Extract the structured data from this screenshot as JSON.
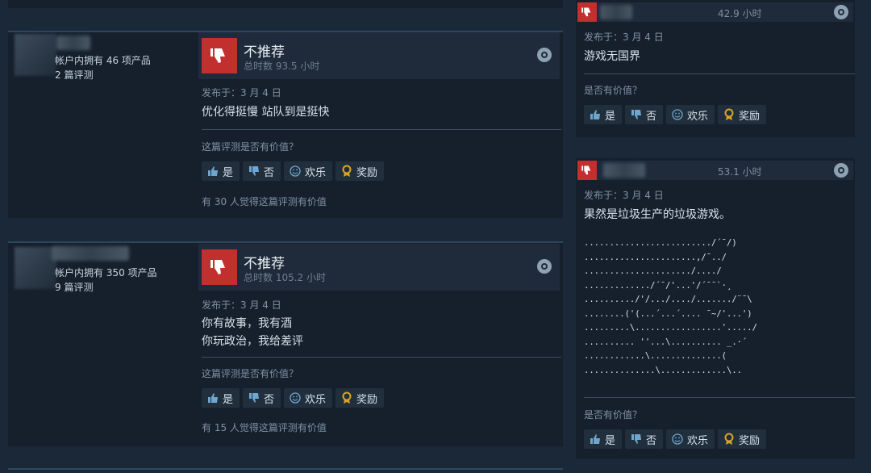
{
  "reviews_left": [
    {
      "author_meta_products": "帐户内拥有 46 项产品",
      "author_meta_reviews": "2 篇评测",
      "vote_title": "不推荐",
      "hours": "总时数 93.5 小时",
      "posted": "发布于：3 月 4 日",
      "body": "优化得挺慢 站队到是挺快",
      "helpful_question": "这篇评测是否有价值？",
      "btn_yes": "是",
      "btn_no": "否",
      "btn_funny": "欢乐",
      "btn_award": "奖励",
      "helpful_count": "有 30 人觉得这篇评测有价值"
    },
    {
      "author_meta_products": "帐户内拥有 350 项产品",
      "author_meta_reviews": "9 篇评测",
      "vote_title": "不推荐",
      "hours": "总时数 105.2 小时",
      "posted": "发布于：3 月 4 日",
      "body": "你有故事，我有酒\n你玩政治，我给差评",
      "helpful_question": "这篇评测是否有价值？",
      "btn_yes": "是",
      "btn_no": "否",
      "btn_funny": "欢乐",
      "btn_award": "奖励",
      "helpful_count": "有 15 人觉得这篇评测有价值"
    }
  ],
  "reviews_right": [
    {
      "hours": "42.9 小时",
      "posted": "发布于：3 月 4 日",
      "body": "游戏无国界",
      "helpful_question": "是否有价值？",
      "btn_yes": "是",
      "btn_no": "否",
      "btn_funny": "欢乐",
      "btn_award": "奖励"
    },
    {
      "hours": "53.1 小时",
      "posted": "发布于：3 月 4 日",
      "body": "果然是垃圾生产的垃圾游戏。",
      "ascii_art": "........................./´¯/)\n......................,/¯../\n...................../..../\n............./´¯/'...'/´¯¯`·¸\n........../'/.../..../......./¨¯\\\n........('(...´...´.... ¯~/'...')\n.........\\.................'...../\n.......... ''...\\.......... _.·´\n............\\..............(\n..............\\.............\\..",
      "helpful_question": "是否有价值？",
      "btn_yes": "是",
      "btn_no": "否",
      "btn_funny": "欢乐",
      "btn_award": "奖励"
    }
  ],
  "colors": {
    "background": "#1b2838",
    "card": "#16202d",
    "not_recommended": "#c12f2f",
    "award": "#d9a521"
  }
}
